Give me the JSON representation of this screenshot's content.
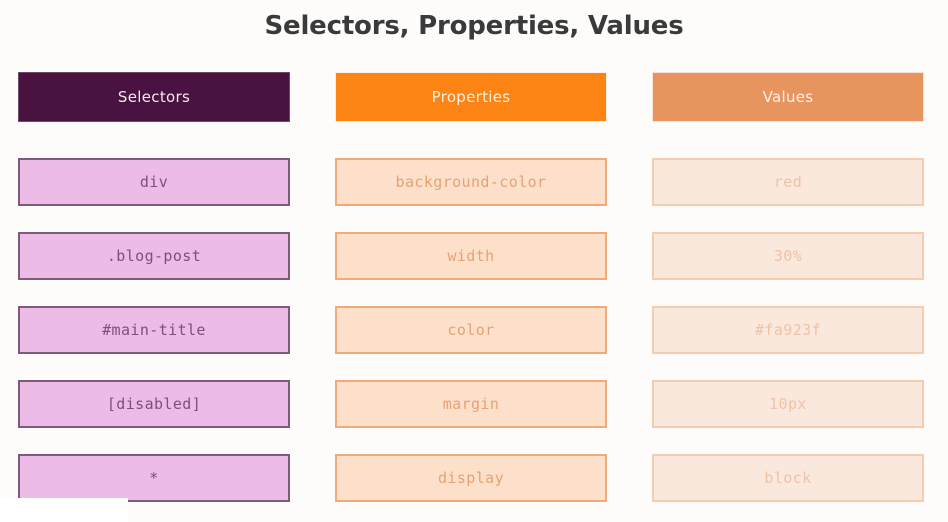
{
  "page": {
    "title": "Selectors, Properties, Values",
    "background_color": "#fdfcfa",
    "title_color": "#3a3a3a"
  },
  "table": {
    "columns": [
      {
        "key": "selectors",
        "header": "Selectors",
        "header_bg": "#4a1240",
        "header_text_color": "#f4eaf2",
        "cell_bg": "#edbbe8",
        "cell_border": "#7c5c78",
        "cell_text_color": "#7a5278"
      },
      {
        "key": "properties",
        "header": "Properties",
        "header_bg": "#fc8414",
        "header_text_color": "#fdeede",
        "cell_bg": "#fce0ca",
        "cell_border": "#eeab7c",
        "cell_text_color": "#e9a173"
      },
      {
        "key": "values",
        "header": "Values",
        "header_bg": "#e8945e",
        "header_text_color": "#fdf2e9",
        "cell_bg": "#fae8dc",
        "cell_border": "#f3cdb2",
        "cell_text_color": "#eec2a5"
      }
    ],
    "rows": [
      {
        "selectors": "div",
        "properties": "background-color",
        "values": "red"
      },
      {
        "selectors": ".blog-post",
        "properties": "width",
        "values": "30%"
      },
      {
        "selectors": "#main-title",
        "properties": "color",
        "values": "#fa923f"
      },
      {
        "selectors": "[disabled]",
        "properties": "margin",
        "values": "10px"
      },
      {
        "selectors": "*",
        "properties": "display",
        "values": "block"
      }
    ]
  }
}
